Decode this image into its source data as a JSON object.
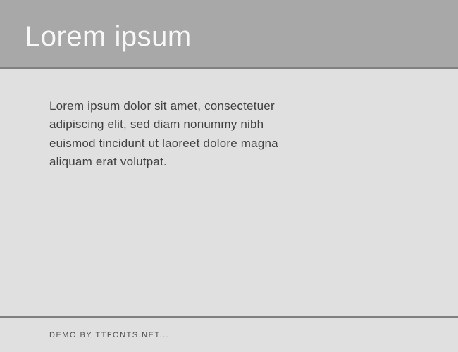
{
  "header": {
    "title": "Lorem ipsum"
  },
  "content": {
    "body_text": "Lorem ipsum dolor sit amet, consectetuer adipiscing elit, sed diam nonummy nibh euismod tincidunt ut laoreet dolore magna aliquam erat volutpat."
  },
  "footer": {
    "text": "DEMO BY TTFONTS.NET..."
  }
}
